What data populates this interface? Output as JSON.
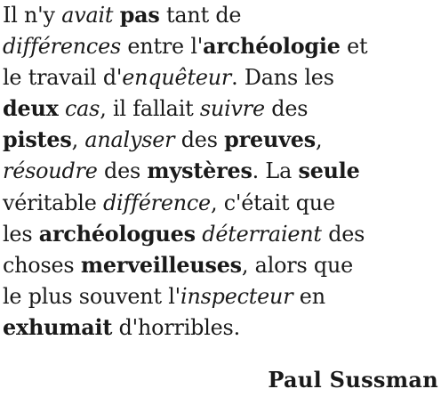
{
  "quote": {
    "lines": [
      [
        {
          "t": "Il n'y ",
          "s": "n"
        },
        {
          "t": "avait",
          "s": "i"
        },
        {
          "t": " ",
          "s": "n"
        },
        {
          "t": "pas",
          "s": "b"
        },
        {
          "t": " tant de",
          "s": "n"
        }
      ],
      [
        {
          "t": "différences",
          "s": "i"
        },
        {
          "t": " entre l'",
          "s": "n"
        },
        {
          "t": "archéologie",
          "s": "b"
        },
        {
          "t": " et",
          "s": "n"
        }
      ],
      [
        {
          "t": "le travail d'",
          "s": "n"
        },
        {
          "t": "enquêteur",
          "s": "i"
        },
        {
          "t": ". Dans les",
          "s": "n"
        }
      ],
      [
        {
          "t": "deux",
          "s": "b"
        },
        {
          "t": " ",
          "s": "n"
        },
        {
          "t": "cas",
          "s": "i"
        },
        {
          "t": ", il fallait ",
          "s": "n"
        },
        {
          "t": "suivre",
          "s": "i"
        },
        {
          "t": " des",
          "s": "n"
        }
      ],
      [
        {
          "t": "pistes",
          "s": "b"
        },
        {
          "t": ", ",
          "s": "n"
        },
        {
          "t": "analyser",
          "s": "i"
        },
        {
          "t": " des ",
          "s": "n"
        },
        {
          "t": "preuves",
          "s": "b"
        },
        {
          "t": ",",
          "s": "n"
        }
      ],
      [
        {
          "t": "résoudre",
          "s": "i"
        },
        {
          "t": " des ",
          "s": "n"
        },
        {
          "t": "mystères",
          "s": "b"
        },
        {
          "t": ". La ",
          "s": "n"
        },
        {
          "t": "seule",
          "s": "b"
        }
      ],
      [
        {
          "t": "véritable ",
          "s": "n"
        },
        {
          "t": "différence",
          "s": "i"
        },
        {
          "t": ", c'était que",
          "s": "n"
        }
      ],
      [
        {
          "t": "les ",
          "s": "n"
        },
        {
          "t": "archéologues",
          "s": "b"
        },
        {
          "t": " ",
          "s": "n"
        },
        {
          "t": "déterraient",
          "s": "i"
        },
        {
          "t": " des",
          "s": "n"
        }
      ],
      [
        {
          "t": "choses ",
          "s": "n"
        },
        {
          "t": "merveilleuses",
          "s": "b"
        },
        {
          "t": ", alors que",
          "s": "n"
        }
      ],
      [
        {
          "t": "le plus souvent l'",
          "s": "n"
        },
        {
          "t": "inspecteur",
          "s": "i"
        },
        {
          "t": " en",
          "s": "n"
        }
      ],
      [
        {
          "t": "exhumait",
          "s": "b"
        },
        {
          "t": " d'horribles.",
          "s": "n"
        }
      ]
    ]
  },
  "author": "Paul Sussman"
}
